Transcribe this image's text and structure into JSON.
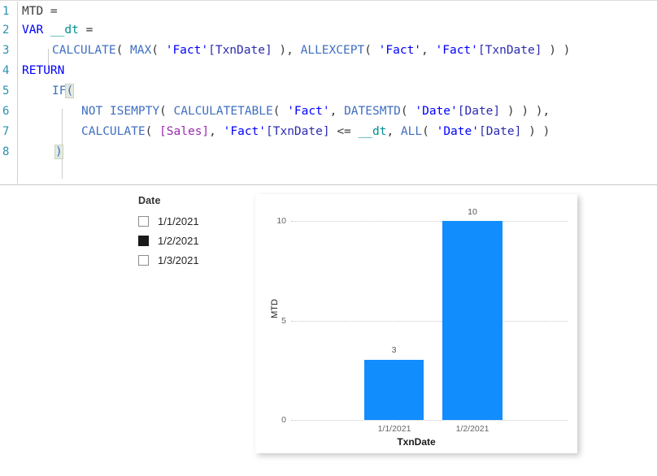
{
  "editor": {
    "lines": [
      {
        "n": "1",
        "text": "MTD ="
      },
      {
        "n": "2",
        "text": "VAR __dt ="
      },
      {
        "n": "3",
        "text": "    CALCULATE( MAX( 'Fact'[TxnDate] ), ALLEXCEPT( 'Fact', 'Fact'[TxnDate] ) )"
      },
      {
        "n": "4",
        "text": "RETURN"
      },
      {
        "n": "5",
        "text": "    IF("
      },
      {
        "n": "6",
        "text": "        NOT ISEMPTY( CALCULATETABLE( 'Fact', DATESMTD( 'Date'[Date] ) ) ),"
      },
      {
        "n": "7",
        "text": "        CALCULATE( [Sales], 'Fact'[TxnDate] <= __dt, ALL( 'Date'[Date] ) )"
      },
      {
        "n": "8",
        "text": "    )"
      }
    ],
    "tokens": {
      "l1": {
        "name": "MTD",
        "eq": " ="
      },
      "l2": {
        "kw": "VAR",
        "var": "__dt",
        "eq": "="
      },
      "l3": {
        "fn1": "CALCULATE",
        "fn2": "MAX",
        "tbl1": "'Fact'",
        "col1": "[TxnDate]",
        "fn3": "ALLEXCEPT",
        "tbl2": "'Fact'",
        "tbl3": "'Fact'",
        "col2": "[TxnDate]"
      },
      "l4": {
        "kw": "RETURN"
      },
      "l5": {
        "fn": "IF",
        "paren": "("
      },
      "l6": {
        "op": "NOT",
        "fn1": "ISEMPTY",
        "fn2": "CALCULATETABLE",
        "tbl": "'Fact'",
        "fn3": "DATESMTD",
        "tbl2": "'Date'",
        "col": "[Date]"
      },
      "l7": {
        "fn1": "CALCULATE",
        "meas": "[Sales]",
        "tbl": "'Fact'",
        "col": "[TxnDate]",
        "op": "<=",
        "var": "__dt",
        "fn2": "ALL",
        "tbl2": "'Date'",
        "col2": "[Date]"
      },
      "l8": {
        "paren": ")"
      }
    }
  },
  "slicer": {
    "title": "Date",
    "items": [
      {
        "label": "1/1/2021",
        "checked": false
      },
      {
        "label": "1/2/2021",
        "checked": true
      },
      {
        "label": "1/3/2021",
        "checked": false
      }
    ]
  },
  "chart_data": {
    "type": "bar",
    "title": "",
    "categories": [
      "1/1/2021",
      "1/2/2021"
    ],
    "values": [
      3,
      10
    ],
    "data_labels": [
      "3",
      "10"
    ],
    "xlabel": "TxnDate",
    "ylabel": "MTD",
    "ylim": [
      0,
      10.8
    ],
    "yticks": [
      0,
      5,
      10
    ],
    "ytick_labels": [
      "0",
      "5",
      "10"
    ],
    "grid": true,
    "legend": false,
    "bar_color": "#118dfe"
  }
}
